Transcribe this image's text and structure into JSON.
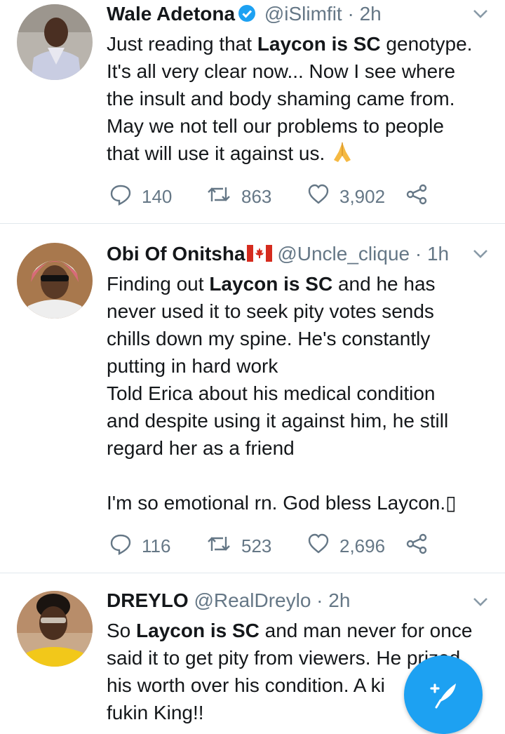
{
  "tweets": [
    {
      "name": "Wale Adetona",
      "handle": "@iSlimfit",
      "sep": "·",
      "time": "2h",
      "verified": true,
      "text_lines": [
        [
          "Just reading that ",
          "Laycon is SC",
          " genotype."
        ],
        [
          "It's all very clear now... Now I see where"
        ],
        [
          "the insult and body shaming came from."
        ],
        [
          "May we not tell our problems to people"
        ],
        [
          "that will use it against us."
        ]
      ],
      "emoji": "folded-hands",
      "replies": "140",
      "retweets": "863",
      "likes": "3,902"
    },
    {
      "name": "Obi Of Onitsha",
      "flag": "canada-flag",
      "handle": "@Uncle_clique",
      "sep": "·",
      "time": "1h",
      "text_lines": [
        [
          "Finding out ",
          "Laycon is SC",
          " and he has"
        ],
        [
          "never used it to seek pity votes sends"
        ],
        [
          "chills down my spine. He's constantly"
        ],
        [
          "putting in hard work"
        ],
        [
          "Told Erica about his medical condition"
        ],
        [
          "and despite using it against him, he still"
        ],
        [
          "regard her as a friend"
        ],
        [
          ""
        ],
        [
          "I'm so emotional rn. God bless Laycon.▯"
        ]
      ],
      "replies": "116",
      "retweets": "523",
      "likes": "2,696"
    },
    {
      "name": "DREYLO",
      "handle": "@RealDreylo",
      "sep": "·",
      "time": "2h",
      "text_lines": [
        [
          "So ",
          "Laycon is SC",
          " and man never for once"
        ],
        [
          "said it to get pity from viewers. He prized"
        ],
        [
          "his worth over his condition. A ki"
        ],
        [
          "fukin King!!"
        ]
      ]
    }
  ],
  "colors": {
    "accent": "#1da1f2",
    "text": "#14171a",
    "secondary": "#657786",
    "divider": "#e1e8ed"
  }
}
